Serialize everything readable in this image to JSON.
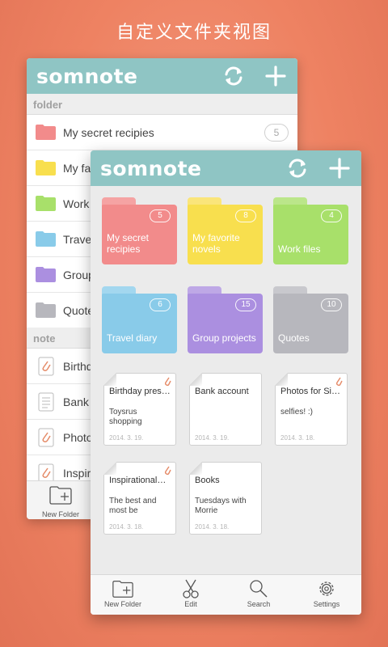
{
  "promo": {
    "title": "自定义文件夹视图"
  },
  "app": {
    "logo": "somnote"
  },
  "back_view": {
    "folder_section": "folder",
    "note_section": "note",
    "folders": [
      {
        "label": "My secret recipies",
        "count": "5",
        "color": "#f28b8b"
      },
      {
        "label": "My fa",
        "color": "#f8df4e"
      },
      {
        "label": "Work",
        "color": "#a8e06a"
      },
      {
        "label": "Trave",
        "color": "#89cbe9"
      },
      {
        "label": "Group",
        "color": "#ab8fe0"
      },
      {
        "label": "Quote",
        "color": "#b7b7bd"
      }
    ],
    "notes": [
      {
        "label": "Birthd",
        "icon": "paperclip-icon"
      },
      {
        "label": "Bank a",
        "icon": "document-icon"
      },
      {
        "label": "Photos",
        "icon": "paperclip-icon"
      },
      {
        "label": "Inspira",
        "icon": "paperclip-icon"
      }
    ],
    "bottom": {
      "new_folder": "New Folder"
    }
  },
  "front_view": {
    "folders": [
      {
        "name": "My secret recipies",
        "count": "5",
        "color": "#f28b8b",
        "tab": "#f5a3a3"
      },
      {
        "name": "My favorite novels",
        "count": "8",
        "color": "#f8df4e",
        "tab": "#fae57a"
      },
      {
        "name": "Work files",
        "count": "4",
        "color": "#a8e06a",
        "tab": "#bbe68a"
      },
      {
        "name": "Travel diary",
        "count": "6",
        "color": "#89cbe9",
        "tab": "#a3d7ef"
      },
      {
        "name": "Group projects",
        "count": "15",
        "color": "#ab8fe0",
        "tab": "#bea8e6"
      },
      {
        "name": "Quotes",
        "count": "10",
        "color": "#b7b7bd",
        "tab": "#c8c8cd"
      }
    ],
    "notes": [
      {
        "title": "Birthday pres…",
        "body": "Toysrus shopping",
        "date": "2014. 3. 19.",
        "clip": true
      },
      {
        "title": "Bank account",
        "body": "",
        "date": "2014. 3. 19.",
        "clip": false
      },
      {
        "title": "Photos for Si…",
        "body": "selfies! :)",
        "date": "2014. 3. 18.",
        "clip": true
      },
      {
        "title": "Inspirational…",
        "body": "The best and most be",
        "date": "2014. 3. 18.",
        "clip": true
      },
      {
        "title": "Books",
        "body": "Tuesdays with Morrie",
        "date": "2014. 3. 18.",
        "clip": false
      }
    ],
    "toolbar": {
      "new_folder": "New Folder",
      "edit": "Edit",
      "search": "Search",
      "settings": "Settings"
    }
  },
  "colors": {
    "accent": "#8fc5c4",
    "background": "#ee8262"
  }
}
